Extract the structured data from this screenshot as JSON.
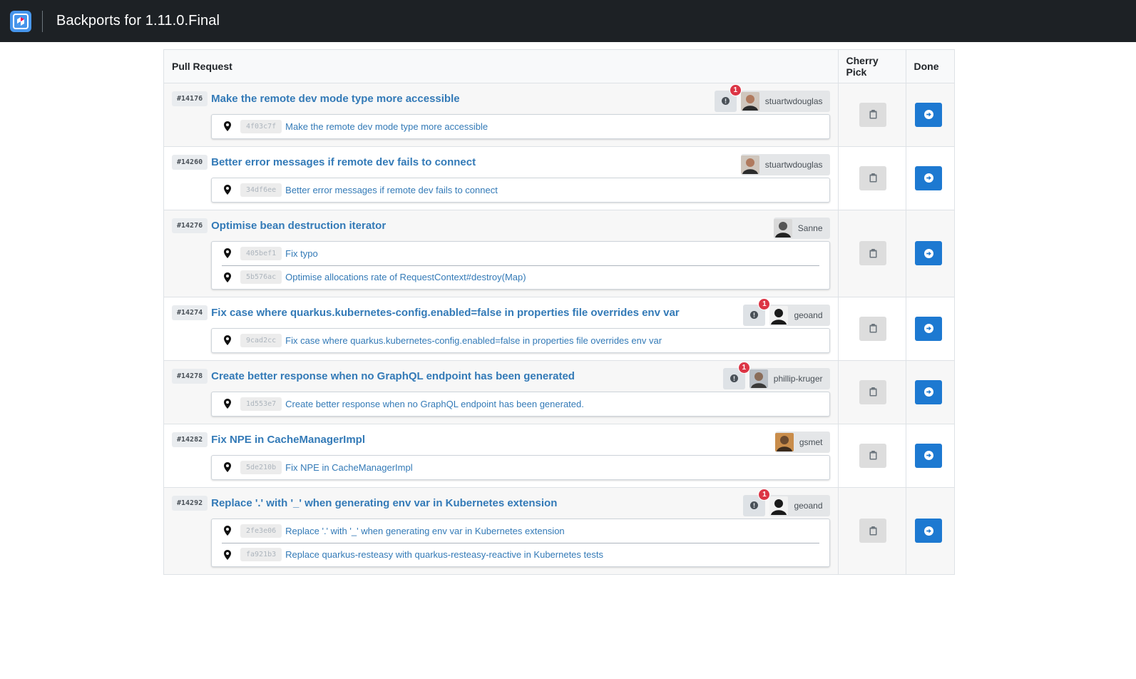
{
  "header": {
    "title": "Backports for 1.11.0.Final",
    "logo_icon": "quarkus-logo-icon"
  },
  "table": {
    "columns": [
      "Pull Request",
      "Cherry Pick",
      "Done"
    ],
    "rows": [
      {
        "number": "#14176",
        "title": "Make the remote dev mode type more accessible",
        "warning_count": "1",
        "user": "stuartwdouglas",
        "commits": [
          {
            "sha": "4f03c7f",
            "message": "Make the remote dev mode type more accessible"
          }
        ]
      },
      {
        "number": "#14260",
        "title": "Better error messages if remote dev fails to connect",
        "warning_count": null,
        "user": "stuartwdouglas",
        "commits": [
          {
            "sha": "34df6ee",
            "message": "Better error messages if remote dev fails to connect"
          }
        ]
      },
      {
        "number": "#14276",
        "title": "Optimise bean destruction iterator",
        "warning_count": null,
        "user": "Sanne",
        "commits": [
          {
            "sha": "405bef1",
            "message": "Fix typo"
          },
          {
            "sha": "5b576ac",
            "message": "Optimise allocations rate of RequestContext#destroy(Map)"
          }
        ]
      },
      {
        "number": "#14274",
        "title": "Fix case where quarkus.kubernetes-config.enabled=false in properties file overrides env var",
        "warning_count": "1",
        "user": "geoand",
        "commits": [
          {
            "sha": "9cad2cc",
            "message": "Fix case where quarkus.kubernetes-config.enabled=false in properties file overrides env var"
          }
        ]
      },
      {
        "number": "#14278",
        "title": "Create better response when no GraphQL endpoint has been generated",
        "warning_count": "1",
        "user": "phillip-kruger",
        "commits": [
          {
            "sha": "1d553e7",
            "message": "Create better response when no GraphQL endpoint has been generated."
          }
        ]
      },
      {
        "number": "#14282",
        "title": "Fix NPE in CacheManagerImpl",
        "warning_count": null,
        "user": "gsmet",
        "commits": [
          {
            "sha": "5de210b",
            "message": "Fix NPE in CacheManagerImpl"
          }
        ]
      },
      {
        "number": "#14292",
        "title": "Replace '.' with '_' when generating env var in Kubernetes extension",
        "warning_count": "1",
        "user": "geoand",
        "commits": [
          {
            "sha": "2fe3e06",
            "message": "Replace '.' with '_' when generating env var in Kubernetes extension"
          },
          {
            "sha": "fa921b3",
            "message": "Replace quarkus-resteasy with quarkus-resteasy-reactive in Kubernetes tests"
          }
        ]
      }
    ]
  },
  "icons": {
    "commit": "map-marker-icon",
    "warning": "exclamation-circle-icon",
    "cherry_pick": "clipboard-icon",
    "done": "arrow-circle-right-icon"
  },
  "colors": {
    "link": "#337ab7",
    "done_button": "#1d79d1",
    "badge": "#dc3545",
    "topbar": "#1d2125"
  }
}
